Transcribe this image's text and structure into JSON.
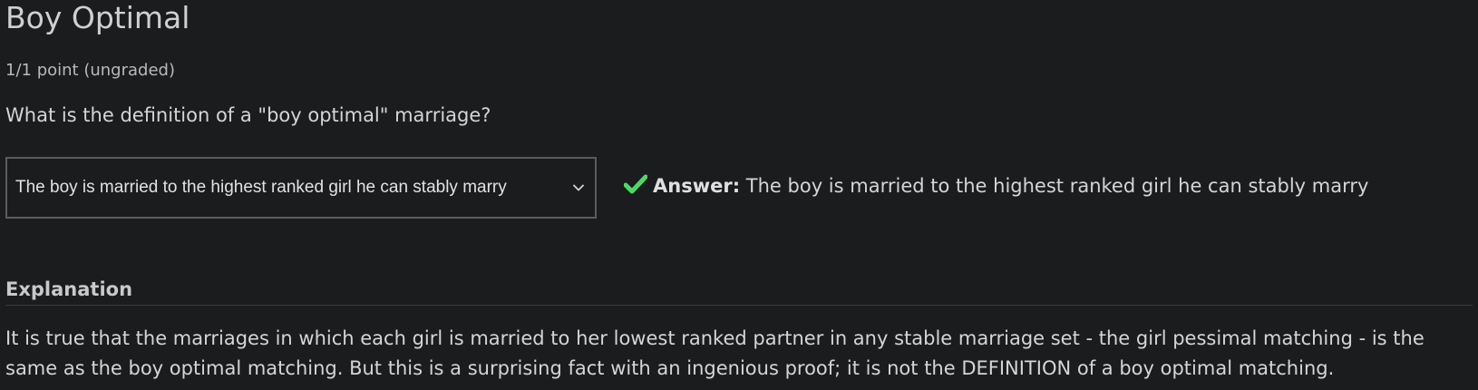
{
  "problem": {
    "title": "Boy Optimal",
    "points": "1/1 point (ungraded)",
    "question": "What is the definition of a \"boy optimal\" marriage?"
  },
  "dropdown": {
    "selected_value": "The boy is married to the highest ranked girl he can stably marry",
    "chevron_icon": "chevron-down-icon"
  },
  "answer": {
    "status_icon": "check-icon",
    "status_color": "#4cd964",
    "label": "Answer:",
    "text": "The boy is married to the highest ranked girl he can stably marry"
  },
  "explanation": {
    "heading": "Explanation",
    "body": "It is true that the marriages in which each girl is married to her lowest ranked partner in any stable marriage set - the girl pessimal matching - is the same as the boy optimal matching. But this is a surprising fact with an ingenious proof; it is not the DEFINITION of a boy optimal matching."
  }
}
